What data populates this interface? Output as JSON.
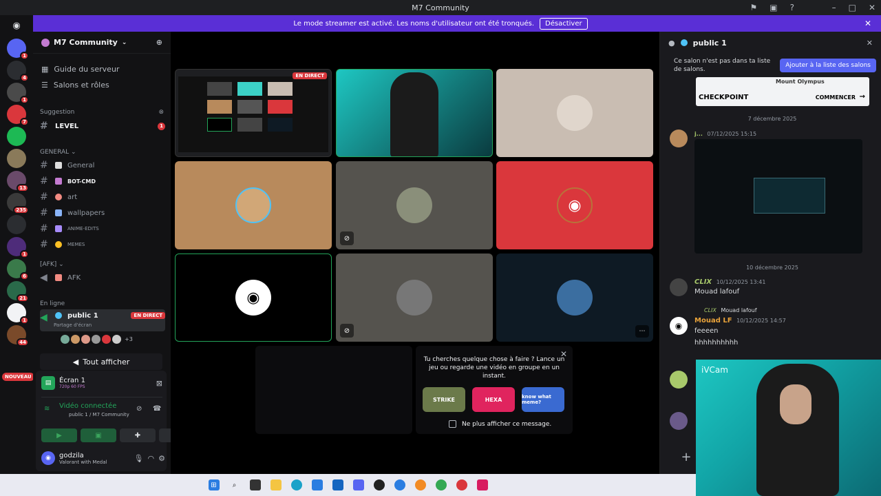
{
  "window": {
    "title": "M7 Community"
  },
  "banner": {
    "text": "Le mode streamer est activé. Les noms d'utilisateur ont été tronqués.",
    "button": "Désactiver"
  },
  "rail": {
    "new_badge": "NOUVEAU",
    "servers": [
      {
        "badge": "1",
        "color": "#5865f2"
      },
      {
        "badge": "4",
        "color": "#2b2d31"
      },
      {
        "badge": "1",
        "color": "#4a4a4a"
      },
      {
        "badge": "7",
        "color": "#da373c"
      },
      {
        "badge": "",
        "color": "#1db954"
      },
      {
        "badge": "",
        "color": "#8a7a5a"
      },
      {
        "badge": "13",
        "color": "#6a4a6a"
      },
      {
        "badge": "235",
        "color": "#3a3a3a"
      },
      {
        "badge": "",
        "color": "#2b2d31"
      },
      {
        "badge": "1",
        "color": "#4e2c7a"
      },
      {
        "badge": "6",
        "color": "#3a7a4a"
      },
      {
        "badge": "21",
        "color": "#2a6a4a"
      },
      {
        "badge": "1",
        "color": "#f2f3f5"
      },
      {
        "badge": "44",
        "color": "#7a4a2a"
      }
    ]
  },
  "sidebar": {
    "guild_name": "M7 Community",
    "nav": [
      "Guide du serveur",
      "Salons et rôles"
    ],
    "suggestion_label": "Suggestion",
    "level_channel": "LEVEL",
    "level_badge": "1",
    "general_category": "GENERAL",
    "channels": [
      {
        "name": "General"
      },
      {
        "name": "BOT-CMD"
      },
      {
        "name": "art"
      },
      {
        "name": "wallpapers"
      },
      {
        "name": "ANIME-EDITS"
      },
      {
        "name": "MEMES"
      }
    ],
    "afk_category": "[AFK]",
    "afk_channel": "AFK",
    "online_label": "En ligne",
    "voice_channel": "public 1",
    "live_tag": "EN DIRECT",
    "voice_sub": "Partage d'écran",
    "extra_users": "+3",
    "show_all": "Tout afficher"
  },
  "panel": {
    "screen_title": "Écran 1",
    "screen_quality": "720p 60 FPS",
    "voice_status": "Vidéo connectée",
    "voice_location": "public 1 / M7 Community",
    "username": "godzila",
    "user_status": "Valorant with Medal"
  },
  "stage": {
    "live_tag": "EN DIRECT",
    "activity": {
      "text": "Tu cherches quelque chose à faire ? Lance un jeu ou regarde une vidéo en groupe en un instant.",
      "games": [
        "STRIKE",
        "HEXA",
        "know what meme?"
      ],
      "checkbox_label": "Ne plus afficher ce message."
    }
  },
  "chat": {
    "channel": "public 1",
    "notice": "Ce salon n'est pas dans ta liste de salons.",
    "add_button": "Ajouter à la liste des salons",
    "embed_title": "CHECKPOINT",
    "embed_subtitle": "Mount Olympus",
    "embed_button": "COMMENCER",
    "date1": "7 décembre 2025",
    "date2": "10 décembre 2025",
    "msg1_time": "07/12/2025 15:15",
    "msg2_name": "CLIX",
    "msg2_time": "10/12/2025 13:41",
    "msg2_text": "Mouad lafouf",
    "reply_name": "CLIX",
    "reply_text": "Mouad lafouf",
    "msg3_name": "Mouad LF",
    "msg3_time": "10/12/2025 14:57",
    "msg3_line1": "feeeen",
    "msg3_line2": "hhhhhhhhhh"
  },
  "cam": {
    "label": "iVCam"
  }
}
